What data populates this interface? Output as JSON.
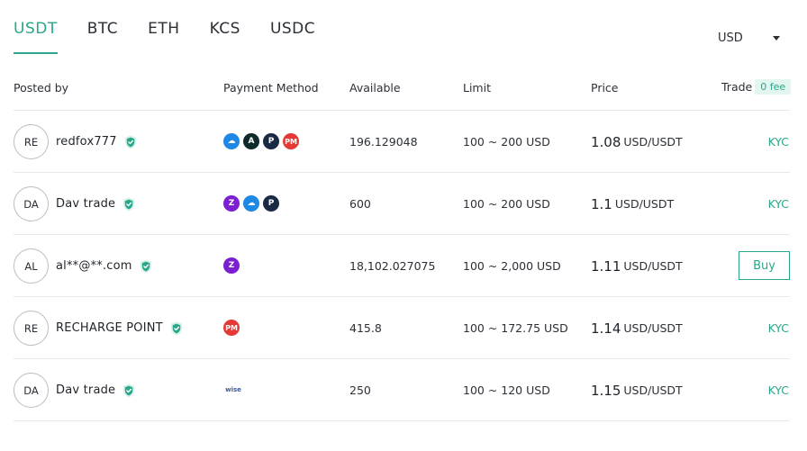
{
  "tabs": [
    {
      "label": "USDT",
      "active": true
    },
    {
      "label": "BTC",
      "active": false
    },
    {
      "label": "ETH",
      "active": false
    },
    {
      "label": "KCS",
      "active": false
    },
    {
      "label": "USDC",
      "active": false
    }
  ],
  "currency_select": {
    "value": "USD"
  },
  "headers": {
    "posted_by": "Posted by",
    "payment_method": "Payment Method",
    "available": "Available",
    "limit": "Limit",
    "price": "Price",
    "trade": "Trade",
    "fee_badge": "0 fee"
  },
  "colors": {
    "accent": "#2aa68a",
    "divider": "#e6e8ea",
    "text": "#1f2329"
  },
  "rows": [
    {
      "avatar": "RE",
      "name": "redfox777",
      "verified": true,
      "payments": [
        {
          "icon": "cloud-pay-icon",
          "color": "#1e88e5",
          "glyph": "☁"
        },
        {
          "icon": "airtm-icon",
          "color": "#0f2a2a",
          "glyph": "A"
        },
        {
          "icon": "payeer-icon",
          "color": "#1b2a44",
          "glyph": "P"
        },
        {
          "icon": "perfect-money-icon",
          "color": "#e53935",
          "glyph": "PM"
        }
      ],
      "available": "196.129048",
      "limit": "100 ~ 200 USD",
      "price": "1.08",
      "price_unit": "USD/USDT",
      "trade": "KYC"
    },
    {
      "avatar": "DA",
      "name": "Dav trade",
      "verified": true,
      "payments": [
        {
          "icon": "zelle-icon",
          "color": "#7b1fd1",
          "glyph": "Z"
        },
        {
          "icon": "cloud-pay-icon",
          "color": "#1e88e5",
          "glyph": "☁"
        },
        {
          "icon": "payeer-icon",
          "color": "#1b2a44",
          "glyph": "P"
        }
      ],
      "available": "600",
      "limit": "100 ~ 200 USD",
      "price": "1.1",
      "price_unit": "USD/USDT",
      "trade": "KYC"
    },
    {
      "avatar": "AL",
      "name": "al**@**.com",
      "verified": true,
      "payments": [
        {
          "icon": "zelle-icon",
          "color": "#7b1fd1",
          "glyph": "Z"
        }
      ],
      "available": "18,102.027075",
      "limit": "100 ~ 2,000 USD",
      "price": "1.11",
      "price_unit": "USD/USDT",
      "trade": "Buy"
    },
    {
      "avatar": "RE",
      "name": "RECHARGE POINT",
      "verified": true,
      "payments": [
        {
          "icon": "perfect-money-icon",
          "color": "#e53935",
          "glyph": "PM"
        }
      ],
      "available": "415.8",
      "limit": "100 ~ 172.75 USD",
      "price": "1.14",
      "price_unit": "USD/USDT",
      "trade": "KYC"
    },
    {
      "avatar": "DA",
      "name": "Dav trade",
      "verified": true,
      "payments": [
        {
          "icon": "wise-icon",
          "color": "#3a5a9a",
          "glyph": "wise"
        }
      ],
      "available": "250",
      "limit": "100 ~ 120 USD",
      "price": "1.15",
      "price_unit": "USD/USDT",
      "trade": "KYC"
    }
  ]
}
